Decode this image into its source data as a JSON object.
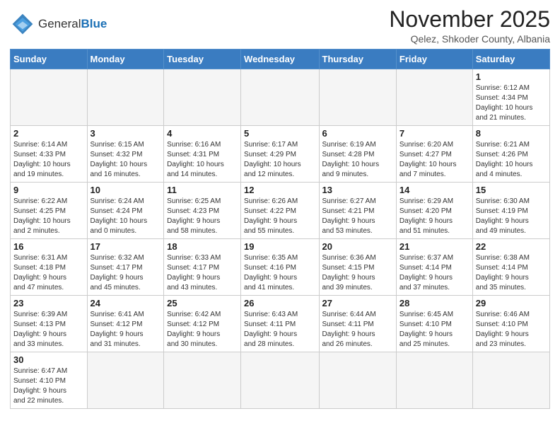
{
  "header": {
    "logo_general": "General",
    "logo_blue": "Blue",
    "month_title": "November 2025",
    "location": "Qelez, Shkoder County, Albania"
  },
  "weekdays": [
    "Sunday",
    "Monday",
    "Tuesday",
    "Wednesday",
    "Thursday",
    "Friday",
    "Saturday"
  ],
  "weeks": [
    [
      {
        "day": "",
        "info": ""
      },
      {
        "day": "",
        "info": ""
      },
      {
        "day": "",
        "info": ""
      },
      {
        "day": "",
        "info": ""
      },
      {
        "day": "",
        "info": ""
      },
      {
        "day": "",
        "info": ""
      },
      {
        "day": "1",
        "info": "Sunrise: 6:12 AM\nSunset: 4:34 PM\nDaylight: 10 hours\nand 21 minutes."
      }
    ],
    [
      {
        "day": "2",
        "info": "Sunrise: 6:14 AM\nSunset: 4:33 PM\nDaylight: 10 hours\nand 19 minutes."
      },
      {
        "day": "3",
        "info": "Sunrise: 6:15 AM\nSunset: 4:32 PM\nDaylight: 10 hours\nand 16 minutes."
      },
      {
        "day": "4",
        "info": "Sunrise: 6:16 AM\nSunset: 4:31 PM\nDaylight: 10 hours\nand 14 minutes."
      },
      {
        "day": "5",
        "info": "Sunrise: 6:17 AM\nSunset: 4:29 PM\nDaylight: 10 hours\nand 12 minutes."
      },
      {
        "day": "6",
        "info": "Sunrise: 6:19 AM\nSunset: 4:28 PM\nDaylight: 10 hours\nand 9 minutes."
      },
      {
        "day": "7",
        "info": "Sunrise: 6:20 AM\nSunset: 4:27 PM\nDaylight: 10 hours\nand 7 minutes."
      },
      {
        "day": "8",
        "info": "Sunrise: 6:21 AM\nSunset: 4:26 PM\nDaylight: 10 hours\nand 4 minutes."
      }
    ],
    [
      {
        "day": "9",
        "info": "Sunrise: 6:22 AM\nSunset: 4:25 PM\nDaylight: 10 hours\nand 2 minutes."
      },
      {
        "day": "10",
        "info": "Sunrise: 6:24 AM\nSunset: 4:24 PM\nDaylight: 10 hours\nand 0 minutes."
      },
      {
        "day": "11",
        "info": "Sunrise: 6:25 AM\nSunset: 4:23 PM\nDaylight: 9 hours\nand 58 minutes."
      },
      {
        "day": "12",
        "info": "Sunrise: 6:26 AM\nSunset: 4:22 PM\nDaylight: 9 hours\nand 55 minutes."
      },
      {
        "day": "13",
        "info": "Sunrise: 6:27 AM\nSunset: 4:21 PM\nDaylight: 9 hours\nand 53 minutes."
      },
      {
        "day": "14",
        "info": "Sunrise: 6:29 AM\nSunset: 4:20 PM\nDaylight: 9 hours\nand 51 minutes."
      },
      {
        "day": "15",
        "info": "Sunrise: 6:30 AM\nSunset: 4:19 PM\nDaylight: 9 hours\nand 49 minutes."
      }
    ],
    [
      {
        "day": "16",
        "info": "Sunrise: 6:31 AM\nSunset: 4:18 PM\nDaylight: 9 hours\nand 47 minutes."
      },
      {
        "day": "17",
        "info": "Sunrise: 6:32 AM\nSunset: 4:17 PM\nDaylight: 9 hours\nand 45 minutes."
      },
      {
        "day": "18",
        "info": "Sunrise: 6:33 AM\nSunset: 4:17 PM\nDaylight: 9 hours\nand 43 minutes."
      },
      {
        "day": "19",
        "info": "Sunrise: 6:35 AM\nSunset: 4:16 PM\nDaylight: 9 hours\nand 41 minutes."
      },
      {
        "day": "20",
        "info": "Sunrise: 6:36 AM\nSunset: 4:15 PM\nDaylight: 9 hours\nand 39 minutes."
      },
      {
        "day": "21",
        "info": "Sunrise: 6:37 AM\nSunset: 4:14 PM\nDaylight: 9 hours\nand 37 minutes."
      },
      {
        "day": "22",
        "info": "Sunrise: 6:38 AM\nSunset: 4:14 PM\nDaylight: 9 hours\nand 35 minutes."
      }
    ],
    [
      {
        "day": "23",
        "info": "Sunrise: 6:39 AM\nSunset: 4:13 PM\nDaylight: 9 hours\nand 33 minutes."
      },
      {
        "day": "24",
        "info": "Sunrise: 6:41 AM\nSunset: 4:12 PM\nDaylight: 9 hours\nand 31 minutes."
      },
      {
        "day": "25",
        "info": "Sunrise: 6:42 AM\nSunset: 4:12 PM\nDaylight: 9 hours\nand 30 minutes."
      },
      {
        "day": "26",
        "info": "Sunrise: 6:43 AM\nSunset: 4:11 PM\nDaylight: 9 hours\nand 28 minutes."
      },
      {
        "day": "27",
        "info": "Sunrise: 6:44 AM\nSunset: 4:11 PM\nDaylight: 9 hours\nand 26 minutes."
      },
      {
        "day": "28",
        "info": "Sunrise: 6:45 AM\nSunset: 4:10 PM\nDaylight: 9 hours\nand 25 minutes."
      },
      {
        "day": "29",
        "info": "Sunrise: 6:46 AM\nSunset: 4:10 PM\nDaylight: 9 hours\nand 23 minutes."
      }
    ],
    [
      {
        "day": "30",
        "info": "Sunrise: 6:47 AM\nSunset: 4:10 PM\nDaylight: 9 hours\nand 22 minutes."
      },
      {
        "day": "",
        "info": ""
      },
      {
        "day": "",
        "info": ""
      },
      {
        "day": "",
        "info": ""
      },
      {
        "day": "",
        "info": ""
      },
      {
        "day": "",
        "info": ""
      },
      {
        "day": "",
        "info": ""
      }
    ]
  ]
}
